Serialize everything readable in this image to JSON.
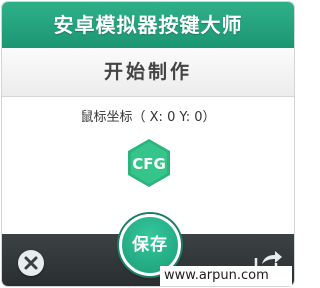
{
  "app": {
    "title": "安卓模拟器按键大师"
  },
  "header": {
    "action_title": "开始制作"
  },
  "coords": {
    "label": "鼠标坐标（ X: ",
    "x": "0",
    "sep": " Y: ",
    "y": "0",
    "close": "）"
  },
  "logo": {
    "text": "CFG",
    "color": "#2bb57d"
  },
  "toolbar": {
    "save_label": "保存",
    "close_icon": "close-icon",
    "share_icon": "share-icon"
  },
  "watermark": {
    "text": "www.arpun.com"
  },
  "colors": {
    "accent": "#1e9a74",
    "bottombar": "#33383a"
  }
}
